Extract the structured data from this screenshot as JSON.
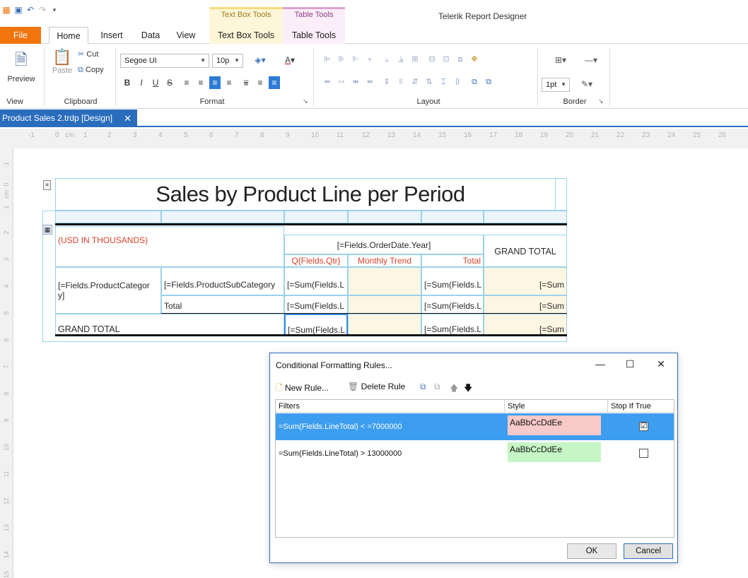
{
  "titlebar": {
    "app_title": "Telerik Report Designer",
    "ctx_textbox_tools": "Text Box Tools",
    "ctx_table_tools": "Table Tools"
  },
  "tabs": {
    "file": "File",
    "home": "Home",
    "insert": "Insert",
    "data": "Data",
    "view": "View",
    "text_box_tools": "Text Box Tools",
    "table_tools": "Table Tools"
  },
  "ribbon": {
    "view_group": {
      "label": "View",
      "preview": "Preview"
    },
    "clipboard_group": {
      "label": "Clipboard",
      "paste": "Paste",
      "cut": "Cut",
      "copy": "Copy"
    },
    "format_group": {
      "label": "Format",
      "font_name": "Segoe UI",
      "font_size": "10p"
    },
    "layout_group": {
      "label": "Layout"
    },
    "border_group": {
      "label": "Border",
      "width": "1pt"
    }
  },
  "document_tab": {
    "label": "Product Sales 2.trdp [Design]",
    "close": "✕"
  },
  "ruler": {
    "horizontal": [
      "-1",
      "0",
      "cm",
      "1",
      "2",
      "3",
      "4",
      "5",
      "6",
      "7",
      "8",
      "9",
      "10",
      "11",
      "12",
      "13",
      "14",
      "15",
      "16",
      "17",
      "18",
      "19",
      "20",
      "21",
      "22",
      "23",
      "24",
      "25",
      "26"
    ],
    "vertical": [
      "-1",
      "0",
      "cm",
      "1",
      "2",
      "3",
      "4",
      "5",
      "6",
      "7",
      "8",
      "9",
      "10",
      "11",
      "12",
      "13",
      "14",
      "15"
    ]
  },
  "report": {
    "title": "Sales by Product Line per Period",
    "usd_note": "(USD IN THOUSANDS)",
    "order_year": "[=Fields.OrderDate.Year]",
    "grand_total_header": "GRAND TOTAL",
    "qtr": "Q{Fields.Qtr}",
    "monthly_trend": "Monthly Trend",
    "total_header": "Total",
    "product_category": "[=Fields.ProductCategor",
    "product_category_wrap": "y]",
    "product_subcategory": "[=Fields.ProductSubCategory",
    "sum_cell": "[=Sum(Fields.L",
    "sum_short": "[=Sum",
    "total_row_label": "Total",
    "grand_total_row": "GRAND TOTAL"
  },
  "dialog": {
    "title": "Conditional Formatting Rules...",
    "new_rule": "New Rule...",
    "delete_rule": "Delete Rule",
    "columns": {
      "filters": "Filters",
      "style": "Style",
      "stop_if_true": "Stop If True"
    },
    "rules": [
      {
        "filter": "=Sum(Fields.LineTotal) < =7000000",
        "style_sample": "AaBbCcDdEe",
        "style_color": "#f8c9c9",
        "stop_if_true": "☑"
      },
      {
        "filter": "=Sum(Fields.LineTotal) > 13000000",
        "style_sample": "AaBbCcDdEe",
        "style_color": "#c6f5c6",
        "stop_if_true": ""
      }
    ],
    "ok": "OK",
    "cancel": "Cancel",
    "selected_row_color": "#3d9ef0"
  }
}
